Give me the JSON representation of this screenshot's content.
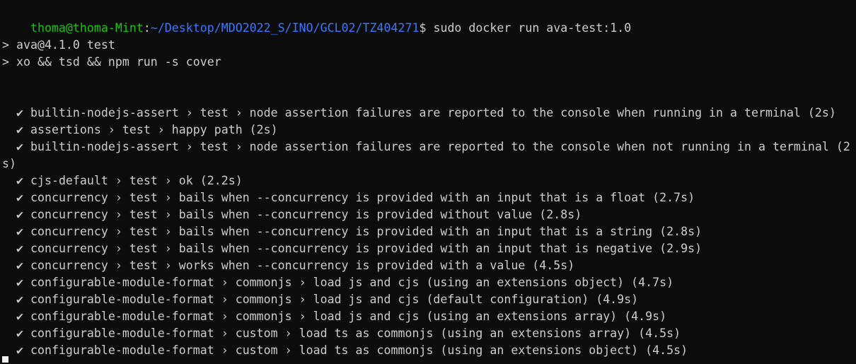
{
  "prompt": {
    "user_host": "thoma@thoma-Mint",
    "separator": ":",
    "path": "~/Desktop/MDO2022_S/INO/GCL02/TZ404271",
    "symbol": "$",
    "command": " sudo docker run ava-test:1.0"
  },
  "npm_header": [
    "> ava@4.1.0 test",
    "> xo && tsd && npm run -s cover"
  ],
  "check_glyph": "✔",
  "test_lines": [
    "builtin-nodejs-assert › test › node assertion failures are reported to the console when running in a terminal (2s)",
    "assertions › test › happy path (2s)",
    "builtin-nodejs-assert › test › node assertion failures are reported to the console when not running in a terminal (2",
    "cjs-default › test › ok (2.2s)",
    "concurrency › test › bails when --concurrency is provided with an input that is a float (2.7s)",
    "concurrency › test › bails when --concurrency is provided without value (2.8s)",
    "concurrency › test › bails when --concurrency is provided with an input that is a string (2.8s)",
    "concurrency › test › bails when --concurrency is provided with an input that is negative (2.9s)",
    "concurrency › test › works when --concurrency is provided with a value (4.5s)",
    "configurable-module-format › commonjs › load js and cjs (using an extensions object) (4.7s)",
    "configurable-module-format › commonjs › load js and cjs (default configuration) (4.9s)",
    "configurable-module-format › commonjs › load js and cjs (using an extensions array) (4.9s)",
    "configurable-module-format › custom › load ts as commonjs (using an extensions array) (4.5s)",
    "configurable-module-format › custom › load ts as commonjs (using an extensions object) (4.5s)"
  ],
  "wrap_continuation": "s)"
}
